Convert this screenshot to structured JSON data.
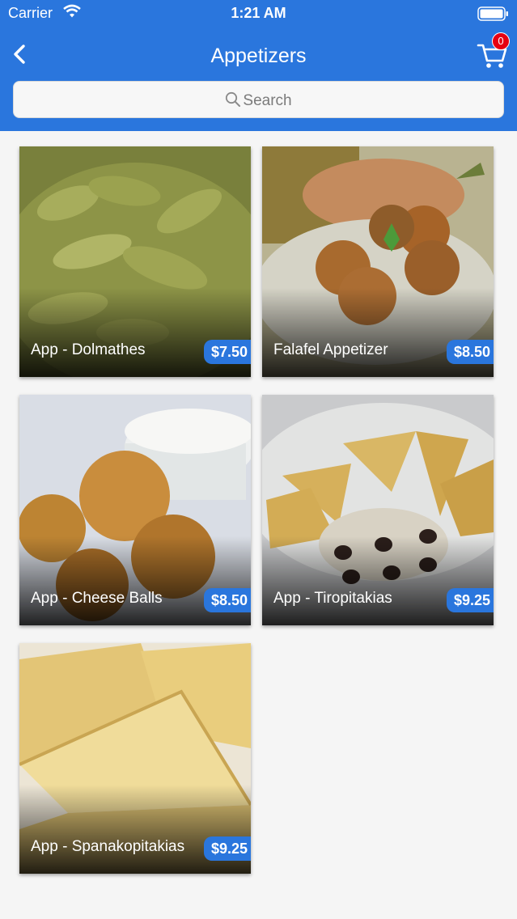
{
  "status_bar": {
    "carrier": "Carrier",
    "time": "1:21 AM"
  },
  "nav": {
    "title": "Appetizers",
    "cart_count": "0"
  },
  "search": {
    "placeholder": "Search"
  },
  "products": [
    {
      "name": "App - Dolmathes",
      "price": "$7.50"
    },
    {
      "name": "Falafel Appetizer",
      "price": "$8.50"
    },
    {
      "name": "App - Cheese Balls",
      "price": "$8.50"
    },
    {
      "name": "App - Tiropitakias",
      "price": "$9.25"
    },
    {
      "name": "App - Spanakopitakias",
      "price": "$9.25"
    }
  ],
  "colors": {
    "brand": "#2a76dd",
    "badge": "#e60012",
    "background": "#f5f5f5"
  }
}
